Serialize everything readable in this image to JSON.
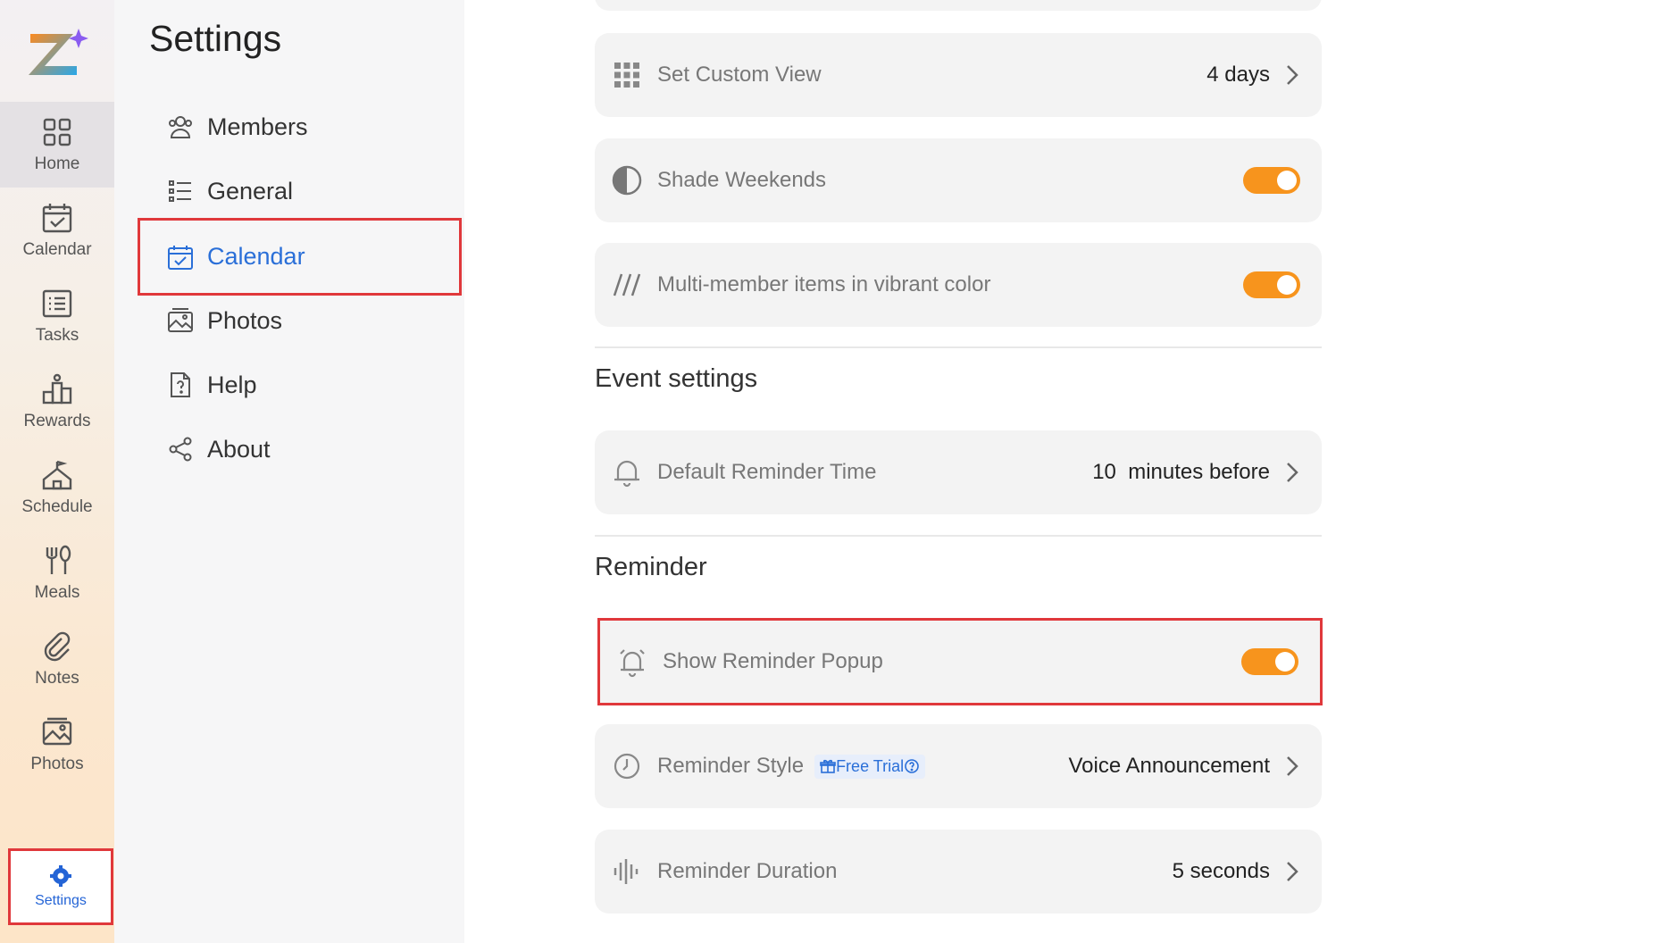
{
  "nav": {
    "items": [
      {
        "label": "Home",
        "icon": "home-grid-icon"
      },
      {
        "label": "Calendar",
        "icon": "calendar-check-icon"
      },
      {
        "label": "Tasks",
        "icon": "tasks-list-icon"
      },
      {
        "label": "Rewards",
        "icon": "rewards-icon"
      },
      {
        "label": "Schedule",
        "icon": "schedule-icon"
      },
      {
        "label": "Meals",
        "icon": "meals-icon"
      },
      {
        "label": "Notes",
        "icon": "paperclip-icon"
      },
      {
        "label": "Photos",
        "icon": "photos-icon"
      }
    ],
    "settings_label": "Settings"
  },
  "settings_panel": {
    "title": "Settings",
    "items": [
      {
        "label": "Members",
        "icon": "members-icon"
      },
      {
        "label": "General",
        "icon": "list-icon"
      },
      {
        "label": "Calendar",
        "icon": "calendar-check-icon"
      },
      {
        "label": "Photos",
        "icon": "photos-icon"
      },
      {
        "label": "Help",
        "icon": "help-doc-icon"
      },
      {
        "label": "About",
        "icon": "share-icon"
      }
    ]
  },
  "calendar_settings": {
    "custom_view": {
      "label": "Set Custom View",
      "value": "4 days"
    },
    "shade_weekends": {
      "label": "Shade Weekends",
      "enabled": true
    },
    "multi_member": {
      "label": "Multi-member items in vibrant color",
      "enabled": true
    }
  },
  "event_settings": {
    "title": "Event settings",
    "default_reminder": {
      "label": "Default Reminder Time",
      "value": "10  minutes before"
    }
  },
  "reminder": {
    "title": "Reminder",
    "show_popup": {
      "label": "Show Reminder Popup",
      "enabled": true
    },
    "style": {
      "label": "Reminder Style",
      "badge": "Free Trial",
      "value": "Voice Announcement"
    },
    "duration": {
      "label": "Reminder Duration",
      "value": "5 seconds"
    }
  },
  "colors": {
    "accent": "#f7941d",
    "active_blue": "#2a6fd8",
    "highlight_red": "#e0383b"
  }
}
